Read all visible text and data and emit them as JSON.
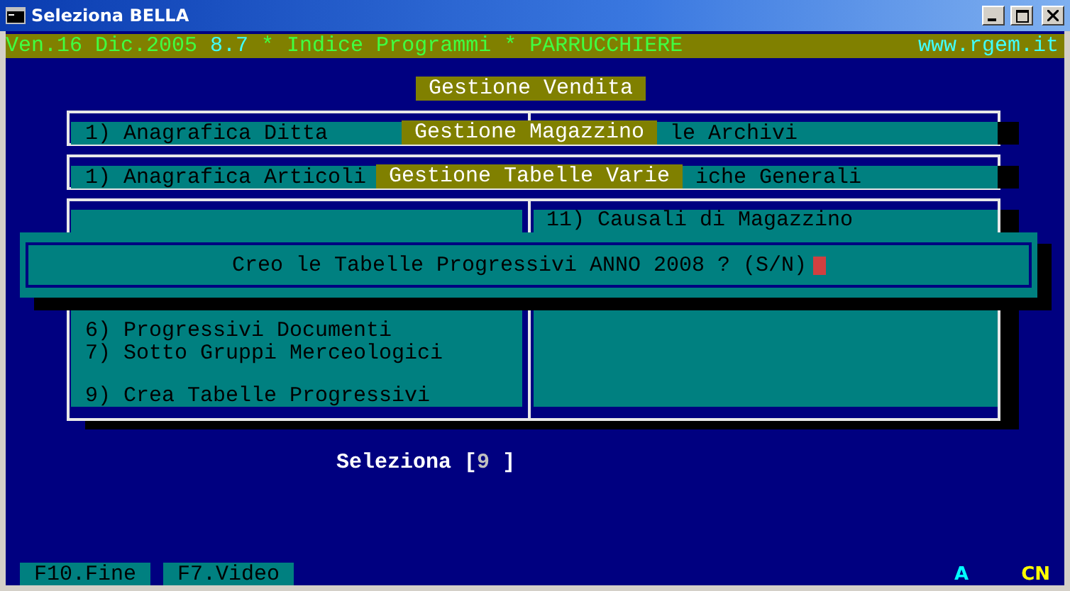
{
  "window": {
    "title": "Seleziona BELLA"
  },
  "header": {
    "date": "Ven.16 Dic.2005",
    "version": "8.7",
    "title": "* Indice Programmi * PARRUCCHIERE",
    "website": "www.rgem.it"
  },
  "menu_titles": [
    "Gestione Vendita",
    "Gestione Magazzino",
    "Gestione Tabelle Varie"
  ],
  "panel_1": {
    "left": "1) Anagrafica Ditta",
    "right": "le Archivi"
  },
  "panel_2": {
    "left": "1) Anagrafica Articoli",
    "right": "iche Generali"
  },
  "panel_3": {
    "left_upper": [
      "6) Progressivi Documenti",
      "7) Sotto Gruppi Merceologici"
    ],
    "left_lower": [
      "9) Crea Tabelle Progressivi"
    ],
    "right": [
      "11) Causali di Magazzino"
    ]
  },
  "dialog": {
    "prompt": "Creo le Tabelle Progressivi ANNO 2008 ? (S/N)"
  },
  "selection": {
    "label": "Seleziona",
    "open": "[",
    "value": "9",
    "close": "]"
  },
  "function_keys": [
    {
      "label": "F10.Fine"
    },
    {
      "label": "F7.Video"
    }
  ],
  "indicators": [
    {
      "text": "A",
      "color": "#00ffff"
    },
    {
      "text": "CN",
      "color": "#ffff00"
    }
  ]
}
